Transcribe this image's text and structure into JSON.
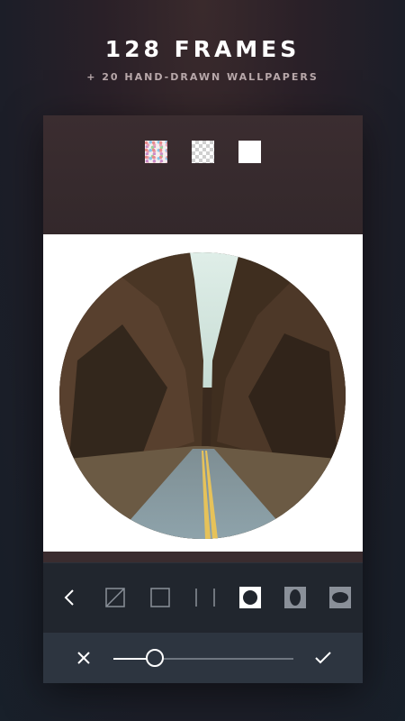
{
  "promo": {
    "headline": "128 FRAMES",
    "subhead": "+ 20 HAND-DRAWN WALLPAPERS"
  },
  "background_swatches": [
    {
      "name": "pattern",
      "icon": "pattern-swatch"
    },
    {
      "name": "transparent",
      "icon": "checkerboard-swatch"
    },
    {
      "name": "white",
      "icon": "white-swatch",
      "color": "#ffffff"
    }
  ],
  "frame_tools": [
    {
      "icon": "chevron-left-icon"
    },
    {
      "icon": "no-frame-icon"
    },
    {
      "icon": "square-frame-icon"
    },
    {
      "icon": "vertical-bars-frame-icon"
    },
    {
      "icon": "circle-frame-icon",
      "selected": true
    },
    {
      "icon": "oval-vertical-frame-icon"
    },
    {
      "icon": "oval-horizontal-frame-icon"
    }
  ],
  "adjust": {
    "slider_value": 0.23,
    "cancel_icon": "close-icon",
    "confirm_icon": "check-icon"
  },
  "colors": {
    "accent": "#ffffff",
    "toolbar": "#21262e",
    "bottom_bar": "#2d3540",
    "top_bar": "#3b2d30"
  }
}
